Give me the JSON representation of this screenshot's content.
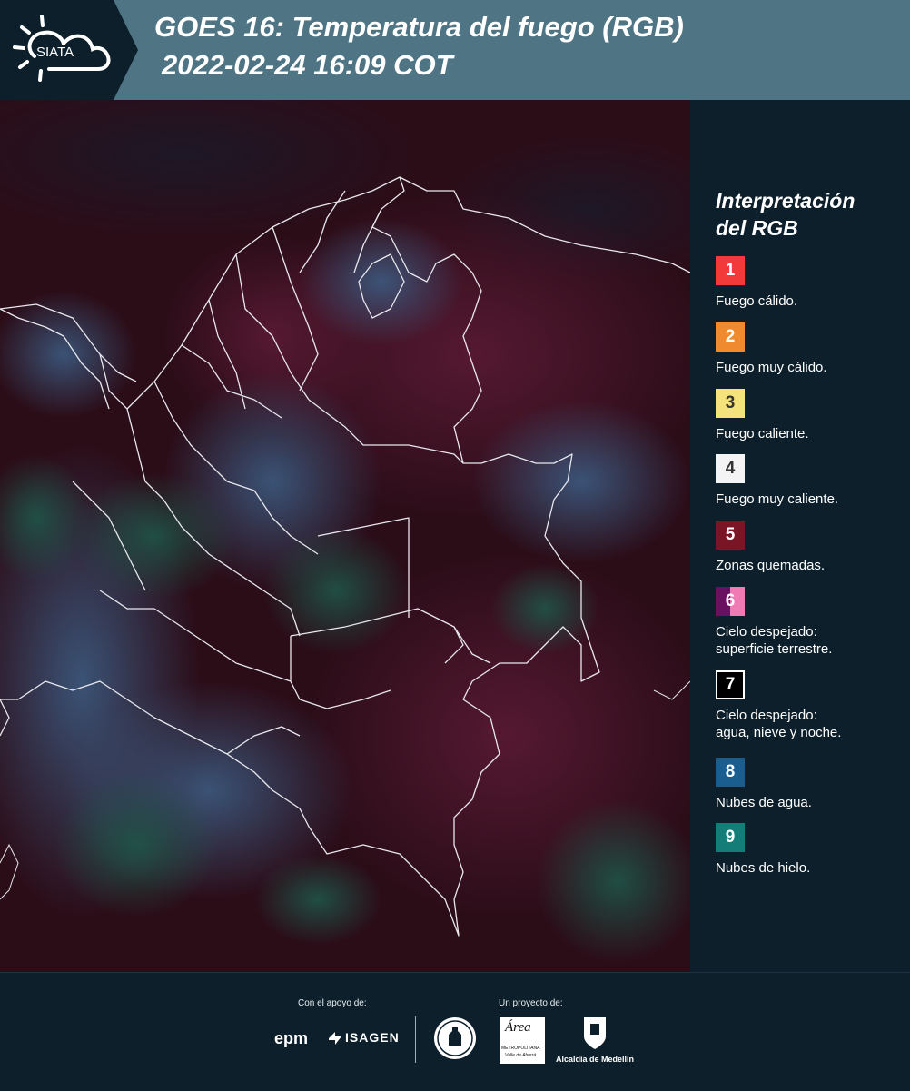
{
  "header": {
    "logo_text": "SIATA",
    "title_line1": "GOES 16: Temperatura del fuego (RGB)",
    "title_line2": "2022-02-24 16:09 COT"
  },
  "legend": {
    "title_line1": "Interpretación",
    "title_line2": "del RGB",
    "items": [
      {
        "number": "1",
        "label": "Fuego cálido.",
        "color": "#f23a3a"
      },
      {
        "number": "2",
        "label": "Fuego muy cálido.",
        "color": "#f08a2e"
      },
      {
        "number": "3",
        "label": "Fuego caliente.",
        "color": "#f4e27a"
      },
      {
        "number": "4",
        "label": "Fuego muy caliente.",
        "color": "#f4f4f4"
      },
      {
        "number": "5",
        "label": "Zonas quemadas.",
        "color": "#7a1526"
      },
      {
        "number": "6",
        "label_line1": "Cielo despejado:",
        "label_line2": "superficie terrestre.",
        "color": "#6a1060",
        "color2": "#f07ab4"
      },
      {
        "number": "7",
        "label_line1": "Cielo despejado:",
        "label_line2": "agua, nieve y noche.",
        "color": "#000000"
      },
      {
        "number": "8",
        "label": "Nubes de agua.",
        "color": "#1a5d8f"
      },
      {
        "number": "9",
        "label": "Nubes de hielo.",
        "color": "#157d78"
      }
    ]
  },
  "footer": {
    "support_label": "Con el apoyo de:",
    "project_label": "Un proyecto de:",
    "logo_epm": "epm",
    "logo_isagen": "ISAGEN",
    "logo_area_title": "Área",
    "logo_area_sub": "METROPOLITANA",
    "logo_area_sub2": "Valle de Aburrá",
    "logo_alcaldia": "Alcaldía de Medellín"
  }
}
